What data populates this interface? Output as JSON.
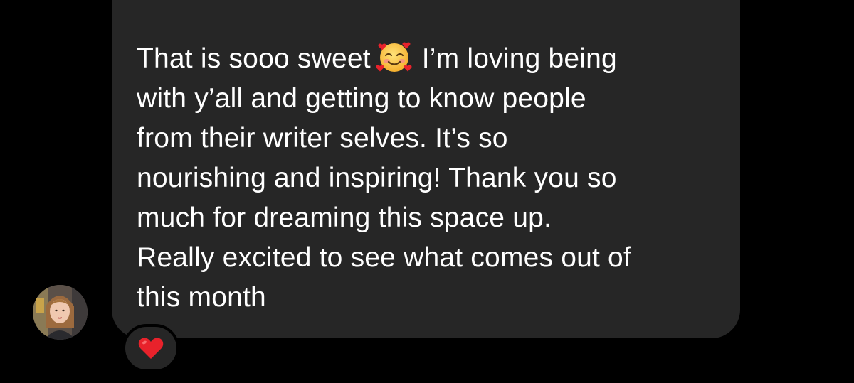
{
  "message": {
    "lines": [
      {
        "before": "That is sooo sweet",
        "emoji": "smiling-face-with-hearts-icon",
        "after": "I’m loving being"
      },
      {
        "text": "with y’all and getting to know people"
      },
      {
        "text": "from their writer selves. It’s so"
      },
      {
        "text": "nourishing and inspiring! Thank you so"
      },
      {
        "text": "much for dreaming this space up."
      },
      {
        "text": "Really excited to see what comes out of"
      },
      {
        "text": "this month"
      }
    ]
  },
  "reaction": {
    "icon": "red-heart-icon",
    "color": "#e8222b"
  },
  "colors": {
    "background": "#000000",
    "bubble": "#262626",
    "text": "#ffffff"
  }
}
